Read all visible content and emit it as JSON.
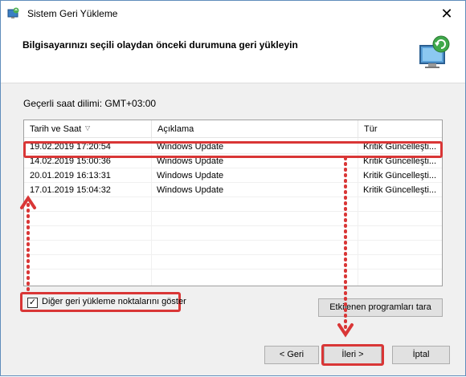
{
  "window": {
    "title": "Sistem Geri Yükleme"
  },
  "header": {
    "heading": "Bilgisayarınızı seçili olaydan önceki durumuna geri yükleyin"
  },
  "timezone": "Geçerli saat dilimi: GMT+03:00",
  "table": {
    "columns": [
      "Tarih ve Saat",
      "Açıklama",
      "Tür"
    ],
    "rows": [
      {
        "date": "19.02.2019 17:20:54",
        "desc": "Windows Update",
        "type": "Kritik Güncelleşti..."
      },
      {
        "date": "14.02.2019 15:00:36",
        "desc": "Windows Update",
        "type": "Kritik Güncelleşti..."
      },
      {
        "date": "20.01.2019 16:13:31",
        "desc": "Windows Update",
        "type": "Kritik Güncelleşti..."
      },
      {
        "date": "17.01.2019 15:04:32",
        "desc": "Windows Update",
        "type": "Kritik Güncelleşti..."
      }
    ]
  },
  "checkbox": {
    "label": "Diğer geri yükleme noktalarını göster",
    "checked": true
  },
  "buttons": {
    "affected": "Etkilenen programları tara",
    "back": "< Geri",
    "next": "İleri >",
    "cancel": "İptal"
  },
  "colors": {
    "highlight": "#d93636",
    "border": "#5f8dbb"
  }
}
